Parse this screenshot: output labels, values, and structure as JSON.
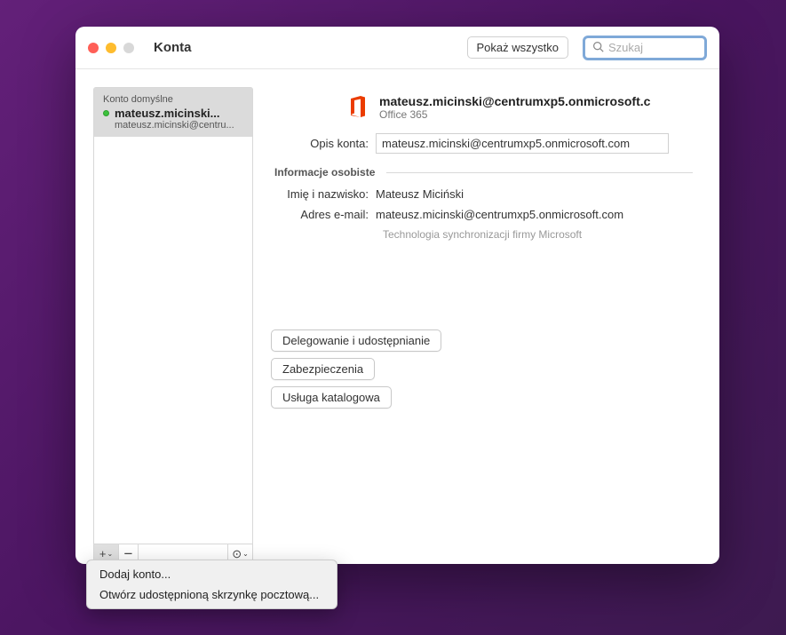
{
  "window": {
    "title": "Konta",
    "show_all_label": "Pokaż wszystko",
    "search_placeholder": "Szukaj"
  },
  "sidebar": {
    "default_label": "Konto domyślne",
    "account_name": "mateusz.micinski...",
    "account_email": "mateusz.micinski@centru...",
    "add_icon": "+",
    "remove_icon": "−",
    "more_icon": "⊙"
  },
  "details": {
    "header_email": "mateusz.micinski@centrumxp5.onmicrosoft.c",
    "header_sub": "Office 365",
    "desc_label": "Opis konta:",
    "desc_value": "mateusz.micinski@centrumxp5.onmicrosoft.com",
    "section_personal": "Informacje osobiste",
    "name_label": "Imię i nazwisko:",
    "name_value": "Mateusz Miciński",
    "email_label": "Adres e-mail:",
    "email_value": "mateusz.micinski@centrumxp5.onmicrosoft.com",
    "sync_note": "Technologia synchronizacji firmy Microsoft",
    "buttons": {
      "delegation": "Delegowanie i udostępnianie",
      "security": "Zabezpieczenia",
      "directory": "Usługa katalogowa"
    }
  },
  "popup": {
    "add_account": "Dodaj konto...",
    "open_shared": "Otwórz udostępnioną skrzynkę pocztową..."
  }
}
